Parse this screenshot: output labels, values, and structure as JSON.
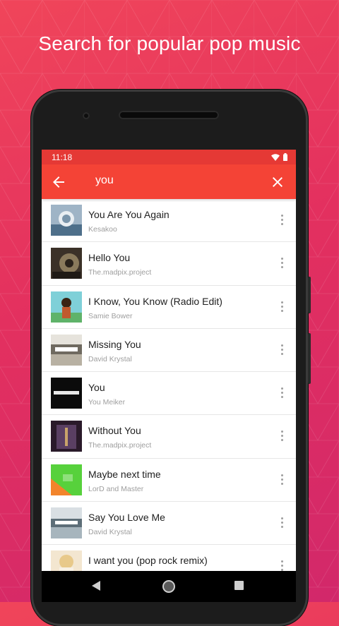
{
  "tagline": "Search for popular pop music",
  "status": {
    "time": "11:18"
  },
  "search": {
    "query": "you"
  },
  "icons": {
    "back": "arrow-left-icon",
    "clear": "close-icon",
    "more": "more-vertical-icon",
    "wifi": "wifi-icon",
    "battery": "battery-icon"
  },
  "colors": {
    "appbar": "#f44336",
    "statusbar": "#e53935",
    "background": "#e3305f"
  },
  "songs": [
    {
      "title": "You Are You Again",
      "artist": "Kesakoo"
    },
    {
      "title": "Hello You",
      "artist": "The.madpix.project"
    },
    {
      "title": "I Know, You Know (Radio Edit)",
      "artist": "Samie Bower"
    },
    {
      "title": "Missing You",
      "artist": "David Krystal"
    },
    {
      "title": "You",
      "artist": "You Meiker"
    },
    {
      "title": "Without You",
      "artist": "The.madpix.project"
    },
    {
      "title": "Maybe next time",
      "artist": "LorD and Master"
    },
    {
      "title": "Say You Love Me",
      "artist": "David Krystal"
    },
    {
      "title": "I want you (pop rock remix)",
      "artist": ""
    }
  ]
}
